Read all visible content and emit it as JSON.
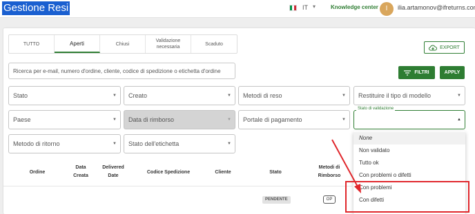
{
  "header": {
    "app_title": "Gestione Resi",
    "language": "IT",
    "knowledge_center": "Knowledge center",
    "avatar_initial": "I",
    "user_email": "ilia.artamonov@ifreturns.com"
  },
  "tabs": [
    {
      "label": "TUTTO",
      "active": false
    },
    {
      "label": "Aperti",
      "active": true
    },
    {
      "label": "Chiusi",
      "active": false
    },
    {
      "label": "Validazione necessaria",
      "active": false
    },
    {
      "label": "Scaduto",
      "active": false
    }
  ],
  "export_label": "EXPORT",
  "search": {
    "placeholder": "Ricerca per e-mail, numero d'ordine, cliente, codice di spedizione o etichetta d'ordine"
  },
  "buttons": {
    "filtri": "FILTRI",
    "apply": "APPLY"
  },
  "filters": {
    "stato": "Stato",
    "creato": "Creato",
    "metodi_reso": "Metodi di reso",
    "restituire_tipo": "Restituire il tipo di modello",
    "paese": "Paese",
    "data_rimborso": "Data di rimborso",
    "portale_pagamento": "Portale di pagamento",
    "stato_validazione_label": "Stato di validazione",
    "metodo_ritorno": "Metodo di ritorno",
    "stato_etichetta": "Stato dell'etichetta"
  },
  "dropdown_options": [
    "None",
    "Non validato",
    "Tutto ok",
    "Con problemi o difetti",
    "Con problemi",
    "Con difetti"
  ],
  "table": {
    "headers": {
      "ordine": "Ordine",
      "data_creata": "Data Creata",
      "delivered_date": "Delivered Date",
      "codice_spedizione": "Codice Spedizione",
      "cliente": "Cliente",
      "stato": "Stato",
      "metodi_rimborso": "Metodi di Rimborso"
    },
    "row": {
      "status": "PENDENTE",
      "method": "OP"
    }
  },
  "colors": {
    "brand_highlight": "#1a5fd0",
    "accent_green": "#2e7d32",
    "annotation_red": "#e0262b"
  }
}
